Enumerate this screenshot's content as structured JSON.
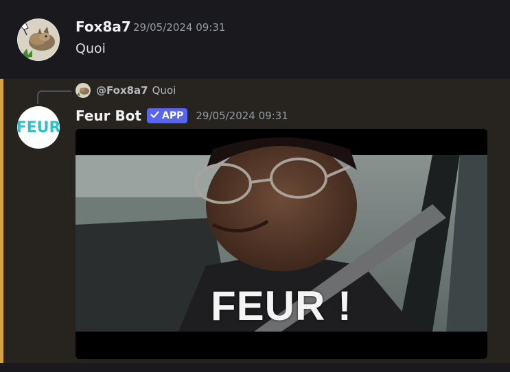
{
  "message1": {
    "author": "Fox8a7",
    "timestamp": "29/05/2024 09:31",
    "content": "Quoi"
  },
  "message2": {
    "reply": {
      "author": "@Fox8a7",
      "text": "Quoi"
    },
    "author": "Feur Bot",
    "badge": "APP",
    "timestamp": "29/05/2024 09:31",
    "avatar_logo": "FEUR",
    "gif_caption": "FEUR !"
  },
  "colors": {
    "background": "#1a1a1e",
    "mention_highlight": "#27231f",
    "mention_bar": "#d4a24c",
    "badge": "#5865f2",
    "logo": "#2cc3c9"
  },
  "icons": {
    "badge_check": "checkmark-icon"
  }
}
